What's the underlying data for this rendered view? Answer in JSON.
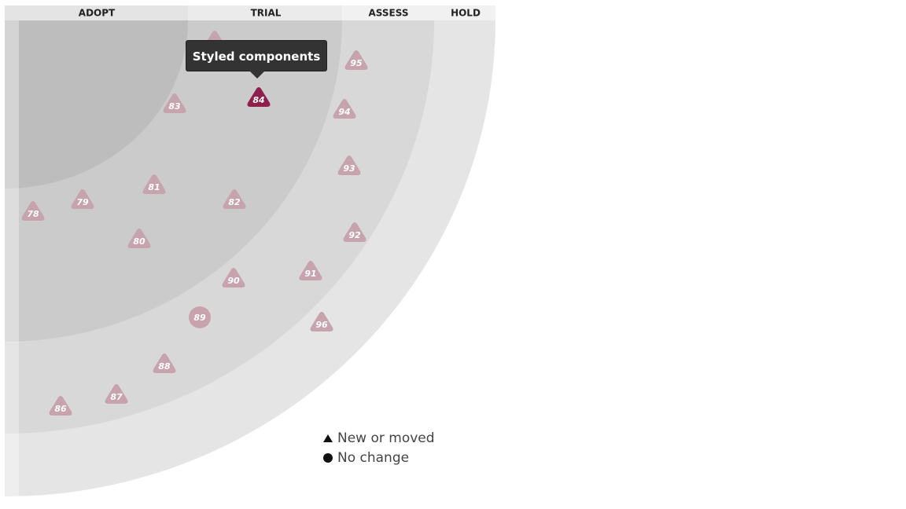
{
  "rings": [
    "ADOPT",
    "TRIAL",
    "ASSESS",
    "HOLD"
  ],
  "colors": {
    "ring_fills": [
      "#bdbdbd",
      "#cbcbcb",
      "#d8d8d8",
      "#e5e5e5"
    ],
    "header_fills": [
      "#e4e4e4",
      "#ebebeb",
      "#f1f1f1",
      "#f1f1f1"
    ],
    "blip_default": "#c7a3ae",
    "blip_active": "#8e1f4a"
  },
  "blips": [
    {
      "id": "78",
      "shape": "triangle",
      "active": false
    },
    {
      "id": "79",
      "shape": "triangle",
      "active": false
    },
    {
      "id": "80",
      "shape": "triangle",
      "active": false
    },
    {
      "id": "81",
      "shape": "triangle",
      "active": false
    },
    {
      "id": "82",
      "shape": "triangle",
      "active": false
    },
    {
      "id": "83",
      "shape": "triangle",
      "active": false
    },
    {
      "id": "84",
      "shape": "triangle",
      "active": true
    },
    {
      "id": "85",
      "shape": "triangle",
      "active": false
    },
    {
      "id": "86",
      "shape": "triangle",
      "active": false
    },
    {
      "id": "87",
      "shape": "triangle",
      "active": false
    },
    {
      "id": "88",
      "shape": "triangle",
      "active": false
    },
    {
      "id": "89",
      "shape": "circle",
      "active": false
    },
    {
      "id": "90",
      "shape": "triangle",
      "active": false
    },
    {
      "id": "91",
      "shape": "triangle",
      "active": false
    },
    {
      "id": "92",
      "shape": "triangle",
      "active": false
    },
    {
      "id": "93",
      "shape": "triangle",
      "active": false
    },
    {
      "id": "94",
      "shape": "triangle",
      "active": false
    },
    {
      "id": "95",
      "shape": "triangle",
      "active": false
    },
    {
      "id": "96",
      "shape": "triangle",
      "active": false
    }
  ],
  "tooltip": {
    "text": "Styled components"
  },
  "legend": {
    "new_or_moved": "New or moved",
    "no_change": "No change"
  }
}
